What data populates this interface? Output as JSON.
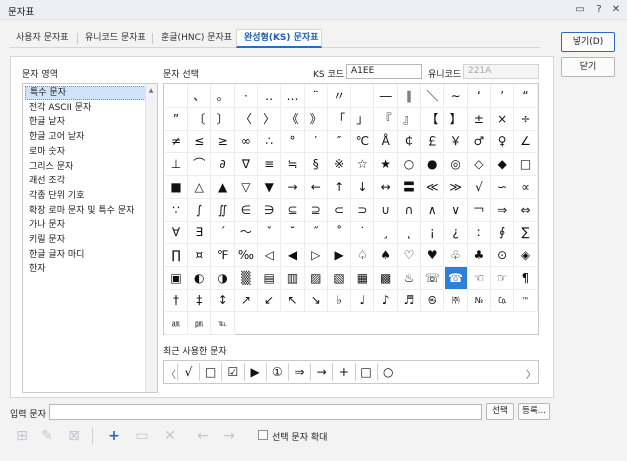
{
  "window": {
    "title": "문자표",
    "help_label": "?"
  },
  "tabs": [
    {
      "label": "사용자 문자표"
    },
    {
      "label": "유니코드 문자표"
    },
    {
      "label": "훈글(HNC) 문자표"
    },
    {
      "label": "완성형(KS) 문자표",
      "active": true
    }
  ],
  "region": {
    "label": "문자 영역",
    "items": [
      "특수 문자",
      "전각 ASCII 문자",
      "한글 낱자",
      "한글 고어 낱자",
      "로마 숫자",
      "그리스 문자",
      "괘선 조각",
      "각종 단위 기호",
      "확장 로마 문자 및 특수 문자",
      "가나 문자",
      "키릴 문자",
      "한글 글자 마디",
      "한자"
    ],
    "selected_index": 0
  },
  "select": {
    "label": "문자 선택",
    "ks_label": "KS 코드",
    "ks_value": "A1EE",
    "unicode_label": "유니코드",
    "unicode_value": "221A"
  },
  "grid": {
    "selected_index": 140,
    "cells": [
      " ",
      "、",
      "。",
      "·",
      "‥",
      "…",
      "¨",
      "〃",
      "­",
      "―",
      "∥",
      "＼",
      "∼",
      "‘",
      "’",
      "“",
      "”",
      "〔",
      "〕",
      "〈",
      "〉",
      "《",
      "》",
      "「",
      "」",
      "『",
      "』",
      "【",
      "】",
      "±",
      "×",
      "÷",
      "≠",
      "≤",
      "≥",
      "∞",
      "∴",
      "°",
      "′",
      "″",
      "℃",
      "Å",
      "￠",
      "￡",
      "￥",
      "♂",
      "♀",
      "∠",
      "⊥",
      "⌒",
      "∂",
      "∇",
      "≡",
      "≒",
      "§",
      "※",
      "☆",
      "★",
      "○",
      "●",
      "◎",
      "◇",
      "◆",
      "□",
      "■",
      "△",
      "▲",
      "▽",
      "▼",
      "→",
      "←",
      "↑",
      "↓",
      "↔",
      "〓",
      "≪",
      "≫",
      "√",
      "∽",
      "∝",
      "∵",
      "∫",
      "∬",
      "∈",
      "∋",
      "⊆",
      "⊇",
      "⊂",
      "⊃",
      "∪",
      "∩",
      "∧",
      "∨",
      "￢",
      "⇒",
      "⇔",
      "∀",
      "∃",
      "´",
      "～",
      "ˇ",
      "˘",
      "˝",
      "˚",
      "˙",
      "¸",
      "˛",
      "¡",
      "¿",
      "ː",
      "∮",
      "∑",
      "∏",
      "¤",
      "℉",
      "‰",
      "◁",
      "◀",
      "▷",
      "▶",
      "♤",
      "♠",
      "♡",
      "♥",
      "♧",
      "♣",
      "⊙",
      "◈",
      "▣",
      "◐",
      "◑",
      "▒",
      "▤",
      "▥",
      "▨",
      "▧",
      "▦",
      "▩",
      "♨",
      "☏",
      "☎",
      "☜",
      "☞",
      "¶",
      "†",
      "‡",
      "↕",
      "↗",
      "↙",
      "↖",
      "↘",
      "♭",
      "♩",
      "♪",
      "♬",
      "㉿",
      "㈜",
      "№",
      "㏇",
      "™",
      "㏂",
      "㏘",
      "℡"
    ]
  },
  "recent": {
    "label": "최근 사용한 문자",
    "chars": [
      "√",
      "□",
      "☑",
      "▶",
      "①",
      "⇒",
      "→",
      "+",
      "□",
      "○"
    ],
    "prev_label": "〈",
    "next_label": "〉"
  },
  "buttons": {
    "insert": "넣기(D)",
    "close": "닫기",
    "select": "선택",
    "register": "등록..."
  },
  "input": {
    "label": "입력 문자",
    "value": ""
  },
  "options": {
    "expand_label": "선택 문자 확대",
    "expand_checked": false
  },
  "toolbar_icons": [
    {
      "name": "add-set-icon",
      "glyph": "⊞",
      "active": false
    },
    {
      "name": "edit-set-icon",
      "glyph": "✎",
      "active": false
    },
    {
      "name": "delete-set-icon",
      "glyph": "⊠",
      "active": false
    },
    {
      "name": "add-icon",
      "glyph": "+",
      "active": true
    },
    {
      "name": "edit-char-icon",
      "glyph": "▭",
      "active": false
    },
    {
      "name": "delete-icon",
      "glyph": "✕",
      "active": false
    },
    {
      "name": "arrow-left-icon",
      "glyph": "←",
      "active": false
    },
    {
      "name": "arrow-right-icon",
      "glyph": "→",
      "active": false
    }
  ]
}
